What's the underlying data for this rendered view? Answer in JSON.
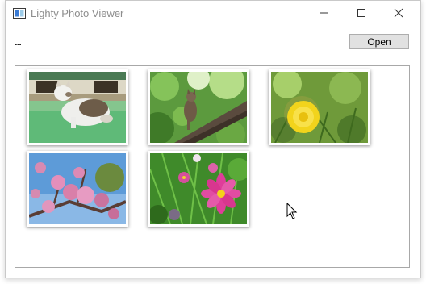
{
  "window": {
    "title": "Lighty Photo Viewer",
    "controls": [
      "minimize-icon",
      "maximize-icon",
      "close-icon"
    ]
  },
  "toolbar": {
    "path_label": "...",
    "open_label": "Open"
  },
  "gallery": {
    "thumbnails": [
      {
        "name": "cat-on-green-mat",
        "icon": "photo-cat"
      },
      {
        "name": "cat-on-tree-branch",
        "icon": "photo-cat-tree"
      },
      {
        "name": "dandelion",
        "icon": "photo-dandelion"
      },
      {
        "name": "plum-blossoms",
        "icon": "photo-plum-blossoms"
      },
      {
        "name": "cosmos-flower",
        "icon": "photo-cosmos"
      }
    ]
  }
}
